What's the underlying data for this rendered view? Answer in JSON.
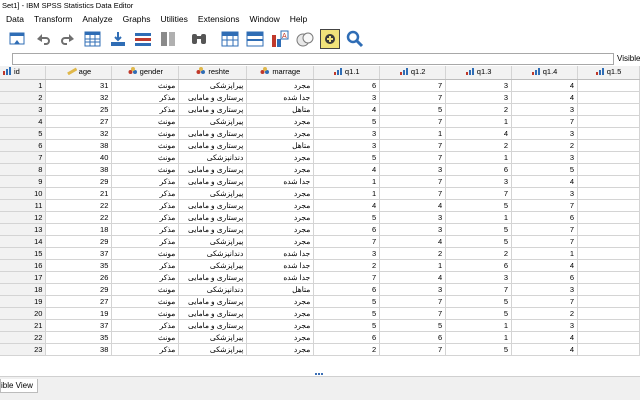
{
  "window": {
    "title": "Set1] - IBM SPSS Statistics Data Editor"
  },
  "menubar": {
    "items": [
      {
        "label": "Data",
        "id": "data"
      },
      {
        "label": "Transform",
        "id": "transform"
      },
      {
        "label": "Analyze",
        "id": "analyze"
      },
      {
        "label": "Graphs",
        "id": "graphs"
      },
      {
        "label": "Utilities",
        "id": "utilities"
      },
      {
        "label": "Extensions",
        "id": "extensions"
      },
      {
        "label": "Window",
        "id": "window"
      },
      {
        "label": "Help",
        "id": "help"
      }
    ]
  },
  "toolbar": {
    "icons": [
      "open-data-icon",
      "undo-icon",
      "redo-icon",
      "goto-case-icon",
      "goto-variable-icon",
      "variables-icon",
      "split-file-icon",
      "find-icon",
      "select-cases-icon",
      "value-labels-icon",
      "insert-variable-icon",
      "spellcheck-icon",
      "use-variable-sets-icon",
      "show-all-variables-icon",
      "search-icon"
    ]
  },
  "cell_editor": {
    "value": "",
    "visible_label": "Visible"
  },
  "columns": [
    {
      "name": "id",
      "type": "scale"
    },
    {
      "name": "age",
      "type": "scale-ruler"
    },
    {
      "name": "gender",
      "type": "nominal"
    },
    {
      "name": "reshte",
      "type": "nominal"
    },
    {
      "name": "marrage",
      "type": "nominal"
    },
    {
      "name": "q1.1",
      "type": "ordinal"
    },
    {
      "name": "q1.2",
      "type": "ordinal"
    },
    {
      "name": "q1.3",
      "type": "ordinal"
    },
    {
      "name": "q1.4",
      "type": "ordinal"
    },
    {
      "name": "q1.5",
      "type": "ordinal"
    }
  ],
  "rows": [
    [
      "1",
      "1",
      "31",
      "مونث",
      "پیراپزشکی",
      "مجرد",
      "6",
      "7",
      "3",
      "4",
      ""
    ],
    [
      "2",
      "2",
      "32",
      "مذکر",
      "پرستاری و مامایی",
      "جدا شده",
      "3",
      "7",
      "3",
      "4",
      ""
    ],
    [
      "3",
      "3",
      "25",
      "مذکر",
      "پرستاری و مامایی",
      "متاهل",
      "4",
      "5",
      "2",
      "3",
      ""
    ],
    [
      "4",
      "4",
      "27",
      "مونث",
      "پیراپزشکی",
      "مجرد",
      "5",
      "7",
      "1",
      "7",
      ""
    ],
    [
      "5",
      "5",
      "32",
      "مونث",
      "پرستاری و مامایی",
      "مجرد",
      "3",
      "1",
      "4",
      "3",
      ""
    ],
    [
      "6",
      "6",
      "38",
      "مونث",
      "پرستاری و مامایی",
      "متاهل",
      "3",
      "7",
      "2",
      "2",
      ""
    ],
    [
      "7",
      "7",
      "40",
      "مونث",
      "دندانپزشکی",
      "مجرد",
      "5",
      "7",
      "1",
      "3",
      ""
    ],
    [
      "8",
      "8",
      "38",
      "مونث",
      "پرستاری و مامایی",
      "مجرد",
      "4",
      "3",
      "6",
      "5",
      ""
    ],
    [
      "9",
      "9",
      "29",
      "مذکر",
      "پرستاری و مامایی",
      "جدا شده",
      "1",
      "7",
      "3",
      "4",
      ""
    ],
    [
      "10",
      "10",
      "21",
      "مذکر",
      "پیراپزشکی",
      "مجرد",
      "1",
      "7",
      "7",
      "3",
      ""
    ],
    [
      "11",
      "11",
      "22",
      "مذکر",
      "پرستاری و مامایی",
      "مجرد",
      "4",
      "4",
      "5",
      "7",
      ""
    ],
    [
      "12",
      "12",
      "22",
      "مذکر",
      "پرستاری و مامایی",
      "مجرد",
      "5",
      "3",
      "1",
      "6",
      ""
    ],
    [
      "13",
      "13",
      "18",
      "مذکر",
      "پرستاری و مامایی",
      "مجرد",
      "6",
      "3",
      "5",
      "7",
      ""
    ],
    [
      "14",
      "14",
      "29",
      "مذکر",
      "پیراپزشکی",
      "مجرد",
      "7",
      "4",
      "5",
      "7",
      ""
    ],
    [
      "15",
      "15",
      "37",
      "مونث",
      "دندانپزشکی",
      "جدا شده",
      "3",
      "2",
      "2",
      "1",
      ""
    ],
    [
      "16",
      "16",
      "35",
      "مذکر",
      "پیراپزشکی",
      "جدا شده",
      "2",
      "1",
      "6",
      "4",
      ""
    ],
    [
      "17",
      "17",
      "26",
      "مذکر",
      "پرستاری و مامایی",
      "جدا شده",
      "7",
      "4",
      "3",
      "6",
      ""
    ],
    [
      "18",
      "18",
      "29",
      "مونث",
      "دندانپزشکی",
      "متاهل",
      "6",
      "3",
      "7",
      "3",
      ""
    ],
    [
      "19",
      "19",
      "27",
      "مونث",
      "پرستاری و مامایی",
      "مجرد",
      "5",
      "7",
      "5",
      "7",
      ""
    ],
    [
      "20",
      "20",
      "19",
      "مونث",
      "پرستاری و مامایی",
      "مجرد",
      "5",
      "7",
      "5",
      "2",
      ""
    ],
    [
      "21",
      "21",
      "37",
      "مذکر",
      "پرستاری و مامایی",
      "مجرد",
      "5",
      "5",
      "1",
      "3",
      ""
    ],
    [
      "22",
      "22",
      "35",
      "مونث",
      "پیراپزشکی",
      "مجرد",
      "6",
      "6",
      "1",
      "4",
      ""
    ],
    [
      "23",
      "23",
      "38",
      "مذکر",
      "پیراپزشکی",
      "مجرد",
      "2",
      "7",
      "5",
      "4",
      ""
    ]
  ],
  "status": {
    "tab_label": "ible View"
  },
  "colors": {
    "accent": "#2f6db5",
    "header_bg": "#f2f2f2",
    "grid_line": "#d4d4d4"
  }
}
